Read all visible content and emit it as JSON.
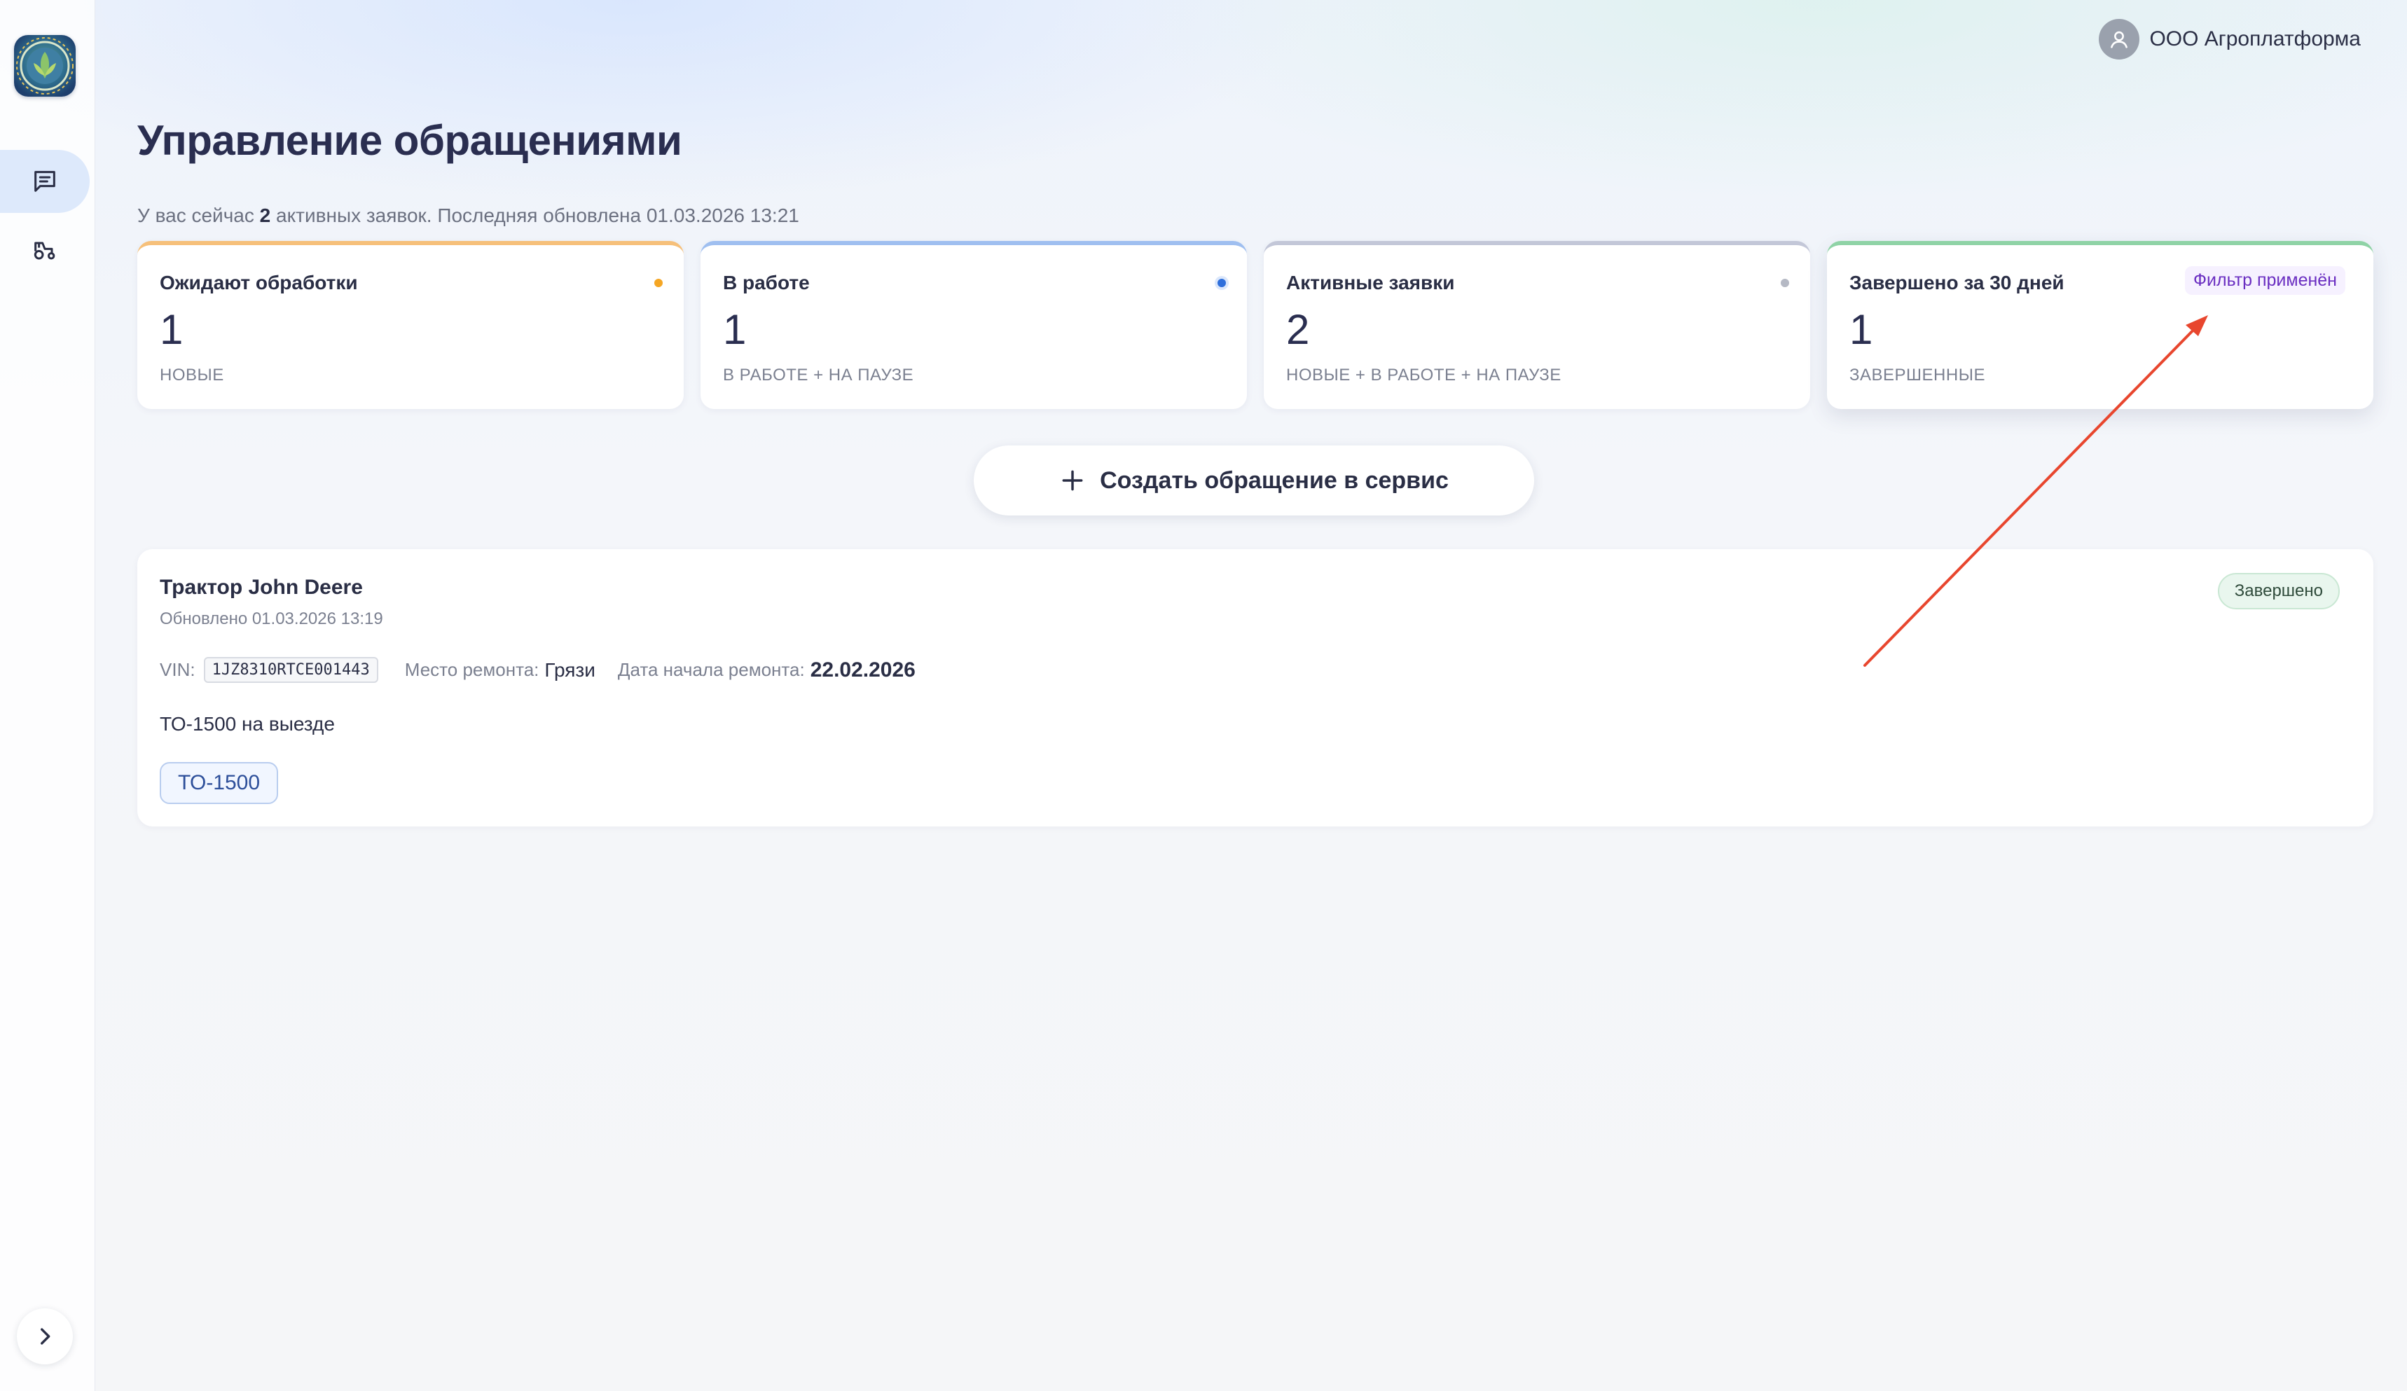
{
  "user": {
    "name": "ООО Агроплатформа",
    "icon": "user-icon"
  },
  "sidebar": {
    "logo": "app-logo",
    "items": [
      {
        "id": "requests",
        "icon": "chat-list-icon",
        "active": true
      },
      {
        "id": "tractors",
        "icon": "tractor-icon",
        "active": false
      }
    ],
    "expand_icon": "chevron-right-icon"
  },
  "header": {
    "title": "Управление обращениями",
    "subtitle_prefix": "У вас сейчас ",
    "active_count": "2",
    "subtitle_suffix": " активных заявок. Последняя обновлена 01.03.2026 13:21"
  },
  "stats": [
    {
      "label": "Ожидают обработки",
      "value": "1",
      "caption": "НОВЫЕ",
      "accent": "#f6c07a",
      "dot": "#f5a623"
    },
    {
      "label": "В работе",
      "value": "1",
      "caption": "В РАБОТЕ + НА ПАУЗЕ",
      "accent": "#9fbff0",
      "dot": "#2f6fdb"
    },
    {
      "label": "Активные заявки",
      "value": "2",
      "caption": "НОВЫЕ + В РАБОТЕ + НА ПАУЗЕ",
      "accent": "#c3c7d8",
      "dot": "#b5b9c4"
    },
    {
      "label": "Завершено за 30 дней",
      "value": "1",
      "caption": "ЗАВЕРШЕННЫЕ",
      "accent": "#8fd3a6",
      "badge": "Фильтр применён"
    }
  ],
  "create_button": {
    "label": "Создать обращение в сервис",
    "icon": "plus-icon"
  },
  "requests": [
    {
      "title": "Трактор John Deere",
      "updated": "Обновлено 01.03.2026 13:19",
      "status": "Завершено",
      "vin_label": "VIN:",
      "vin": "1JZ8310RTCE001443",
      "place_label": "Место ремонта:",
      "place": "Грязи",
      "date_label": "Дата начала ремонта:",
      "date": "22.02.2026",
      "description": "ТО-1500 на выезде",
      "tag": "ТО-1500"
    }
  ],
  "annotation": {
    "color": "#e8462e"
  }
}
